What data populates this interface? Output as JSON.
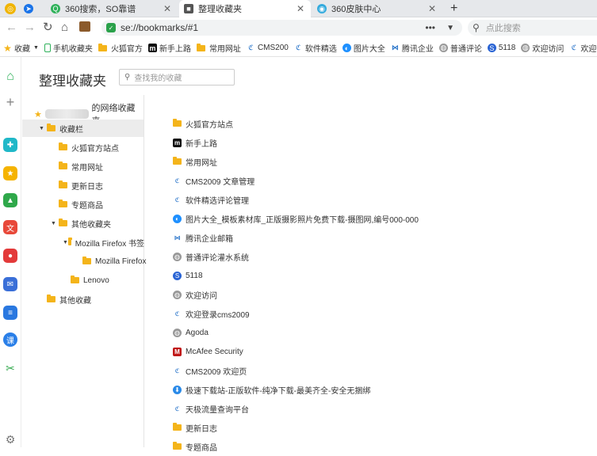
{
  "tabs": [
    {
      "label": "",
      "icon": "browser-logo-icon",
      "color": "#1a73e8"
    },
    {
      "label": "360搜索，SO靠谱",
      "icon": "search360-icon",
      "color": "#2fb15a"
    },
    {
      "label": "整理收藏夹",
      "icon": "bookmark-icon",
      "color": "#555555"
    },
    {
      "label": "360皮肤中心",
      "icon": "skin-icon",
      "color": "#33aadd"
    }
  ],
  "address": {
    "url": "se://bookmarks/#1"
  },
  "search": {
    "placeholder": "点此搜索"
  },
  "bookmarks_bar": [
    {
      "label": "收藏",
      "icon": "star-icon"
    },
    {
      "label": "手机收藏夹",
      "icon": "phone-icon"
    },
    {
      "label": "火狐官方",
      "icon": "folder-icon"
    },
    {
      "label": "新手上路",
      "icon": "m-logo-icon"
    },
    {
      "label": "常用网址",
      "icon": "folder-icon"
    },
    {
      "label": "CMS200",
      "icon": "cms-icon"
    },
    {
      "label": "软件精选",
      "icon": "cms-icon"
    },
    {
      "label": "图片大全",
      "icon": "photo-icon"
    },
    {
      "label": "腾讯企业",
      "icon": "tencent-icon"
    },
    {
      "label": "普通评论",
      "icon": "globe-icon"
    },
    {
      "label": "5118",
      "icon": "s5118-icon"
    },
    {
      "label": "欢迎访问",
      "icon": "globe-icon"
    },
    {
      "label": "欢迎登录",
      "icon": "cms-icon"
    }
  ],
  "page": {
    "title": "整理收藏夹",
    "search_placeholder": "查找我的收藏"
  },
  "tree": {
    "account_suffix": "的网络收藏夹",
    "nodes": [
      {
        "label": "收藏栏"
      },
      {
        "label": "火狐官方站点"
      },
      {
        "label": "常用网址"
      },
      {
        "label": "更新日志"
      },
      {
        "label": "专题商品"
      },
      {
        "label": "其他收藏夹"
      },
      {
        "label": "Mozilla Firefox 书签"
      },
      {
        "label": "Mozilla Firefox"
      },
      {
        "label": "Lenovo"
      },
      {
        "label": "其他收藏"
      }
    ]
  },
  "list": [
    {
      "label": "火狐官方站点",
      "icon": "folder-icon"
    },
    {
      "label": "新手上路",
      "icon": "m-logo-icon"
    },
    {
      "label": "常用网址",
      "icon": "folder-icon"
    },
    {
      "label": "CMS2009 文章管理",
      "icon": "cms-icon"
    },
    {
      "label": "软件精选评论管理",
      "icon": "cms-icon"
    },
    {
      "label": "图片大全_模板素材库_正版摄影照片免费下载-摄图网,编号000-000",
      "icon": "photo-icon"
    },
    {
      "label": "腾讯企业邮箱",
      "icon": "tencent-icon"
    },
    {
      "label": "普通评论灌水系统",
      "icon": "globe-icon"
    },
    {
      "label": "5118",
      "icon": "s5118-icon"
    },
    {
      "label": "欢迎访问",
      "icon": "globe-icon"
    },
    {
      "label": "欢迎登录cms2009",
      "icon": "cms-icon"
    },
    {
      "label": "Agoda",
      "icon": "globe-icon"
    },
    {
      "label": "McAfee Security",
      "icon": "mcafee-icon"
    },
    {
      "label": "CMS2009 欢迎页",
      "icon": "cms-icon"
    },
    {
      "label": "极速下载站-正版软件-纯净下载-最美齐全-安全无捆绑",
      "icon": "download-icon"
    },
    {
      "label": "天极流量查询平台",
      "icon": "cms-icon"
    },
    {
      "label": "更新日志",
      "icon": "folder-icon"
    },
    {
      "label": "专题商品",
      "icon": "folder-icon"
    }
  ],
  "colors": {
    "folder": "#f4b41a",
    "accent": "#1a73e8",
    "mcafee": "#c01818"
  }
}
